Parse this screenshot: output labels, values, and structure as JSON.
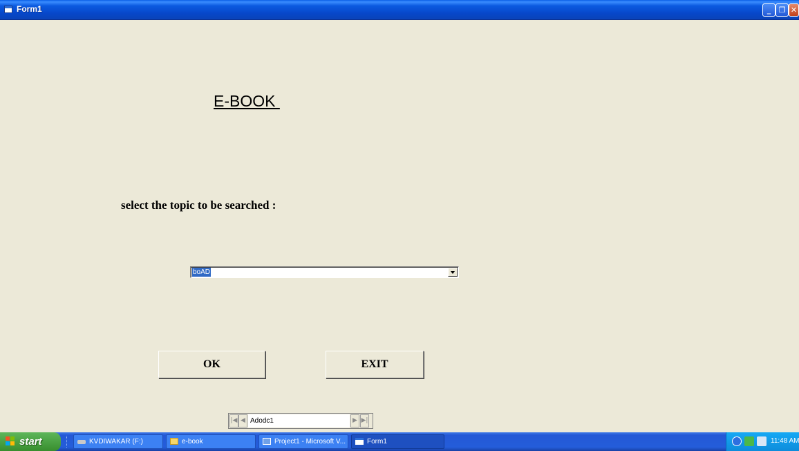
{
  "window": {
    "title": "Form1",
    "minimize_symbol": "_",
    "maximize_symbol": "❐",
    "close_symbol": "✕"
  },
  "form": {
    "heading": "E-BOOK ",
    "prompt": "select the topic to be searched :",
    "topic_combo": {
      "selected_value": "boAD"
    },
    "ok_label": "OK",
    "exit_label": "EXIT",
    "adodc_caption": "Adodc1"
  },
  "taskbar": {
    "start_label": "start",
    "tasks": [
      {
        "label": "KVDIWAKAR (F:)",
        "icon": "drive-icon"
      },
      {
        "label": "e-book",
        "icon": "folder-icon"
      },
      {
        "label": "Project1 - Microsoft V...",
        "icon": "vb-icon"
      },
      {
        "label": "Form1",
        "icon": "form-icon",
        "active": true
      }
    ],
    "clock": "11:48 AM"
  },
  "colors": {
    "form_bg": "#ECE9D8",
    "titlebar": "#0A47C9",
    "selection": "#316AC5"
  }
}
